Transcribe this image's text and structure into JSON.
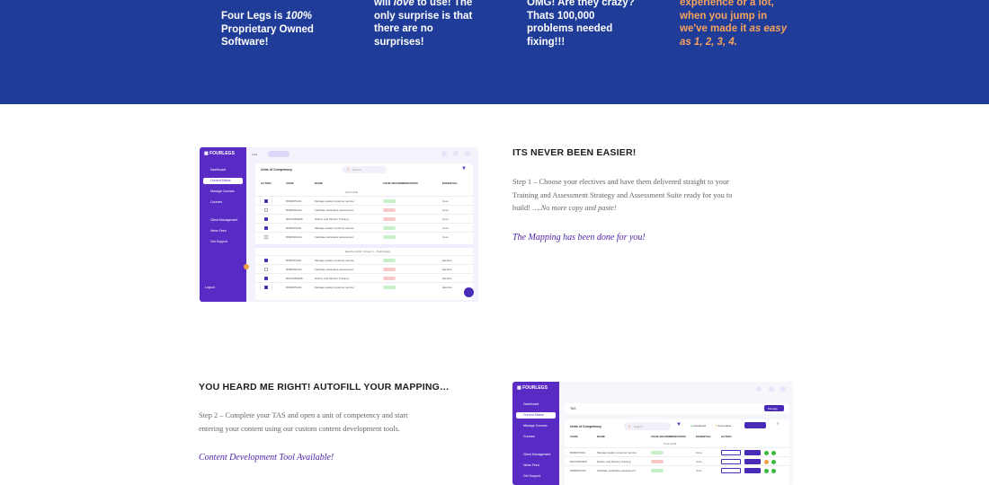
{
  "hero": {
    "col1": {
      "line1_pre": "Four Legs is ",
      "line1_em": "100%",
      "line2": "Proprietary Owned",
      "line3": "Software!"
    },
    "col2": {
      "line0_pre": "will ",
      "line0_em": "love",
      "line0_post": " to use! The",
      "line1": "only surprise is that",
      "line2": "there are no",
      "line3": "surprises!"
    },
    "col3": {
      "line0": "OMG! Are they crazy?",
      "line1": "Thats 100,000",
      "line2": "problems needed",
      "line3": "fixing!!!"
    },
    "col4": {
      "line0": "experience or a lot,",
      "line1": "when you jump in",
      "line2_pre": "we've made it ",
      "line2_em": "as easy",
      "line3_em": "as 1, 2, 3, 4."
    }
  },
  "step1": {
    "title": "ITS NEVER BEEN EASIER!",
    "text_line1": "Step 1 – Choose your electives and have them delivered straight to your",
    "text_line2": "Training and Assessment Strategy and Assessment Suite ready for you to",
    "text_line3_pre": "build!  ",
    "text_line3_em": "….No more copy and paste!",
    "highlight": "The Mapping has been done for you!"
  },
  "step2": {
    "title": "YOU HEARD ME RIGHT!  AUTOFILL YOUR MAPPING…",
    "text_line1": "Step 2 – Complete your TAS and open a unit of competency and start",
    "text_line2": "entering your content using our custom content development tools.",
    "highlight": "Content Development Tool Available!"
  },
  "shot1": {
    "brand": "FOURLEGS",
    "panel_title": "Units of Competency",
    "search_placeholder": "Search",
    "columns": [
      "ACTION",
      "CODE",
      "NAME",
      "COHE RECOMMENDATION",
      "ESSENTIAL"
    ],
    "group1": "Core Units",
    "group2": "Elective Units / Group A – Technology",
    "rows1": [
      {
        "checked": true,
        "code": "BSBOPS401",
        "name": "Manage quality customer service",
        "status": "g",
        "ess": "Core"
      },
      {
        "checked": false,
        "code": "BSBWHS411",
        "name": "Facilitate workplace assessment",
        "status": "r",
        "ess": "Core"
      },
      {
        "checked": true,
        "code": "BSCOMM408",
        "name": "Deliver and Monitor Training",
        "status": "r",
        "ess": "Core"
      },
      {
        "checked": true,
        "code": "BSBOPS401",
        "name": "Manage quality customer service",
        "status": "g",
        "ess": "Core"
      },
      {
        "checked": false,
        "code": "BSBWHS411",
        "name": "Facilitate workplace assessment",
        "status": "g",
        "ess": "Core"
      }
    ],
    "rows2": [
      {
        "checked": true,
        "code": "BSBOPS401",
        "name": "Manage quality customer service",
        "status": "g",
        "ess": "Elective"
      },
      {
        "checked": false,
        "code": "BSBWHS411",
        "name": "Facilitate workplace assessment",
        "status": "r",
        "ess": "Elective"
      },
      {
        "checked": true,
        "code": "BSCOMM408",
        "name": "Deliver and Monitor Training",
        "status": "r",
        "ess": "Elective"
      },
      {
        "checked": true,
        "code": "BSBOPS401",
        "name": "Manage quality customer service",
        "status": "g",
        "ess": "Elective"
      }
    ],
    "side_items": [
      "Dashboard",
      "Current Status",
      "Manage Courses",
      "Courses",
      "Client Management",
      "News Feed",
      "Get Support"
    ],
    "logout": "Logout"
  },
  "shot2": {
    "brand": "FOURLEGS",
    "tas_label": "TAS",
    "panel_title": "Units of Competency",
    "search_placeholder": "Search",
    "columns": [
      "CODE",
      "NAME",
      "COHE RECOMMENDATION",
      "ESSENTIAL",
      "ACTION"
    ],
    "group1": "Core Units",
    "legend": [
      "Completed",
      "Incomplete"
    ],
    "button": "Manage",
    "rows": [
      {
        "code": "BSBOPS401",
        "name": "Manage quality customer service",
        "status": "g",
        "ess": "Core"
      },
      {
        "code": "BSCOMM408",
        "name": "Deliver and Monitor Training",
        "status": "r",
        "ess": "Core"
      },
      {
        "code": "BSBWHS411",
        "name": "Facilitate workplace assessment",
        "status": "g",
        "ess": "Core"
      }
    ],
    "side_items": [
      "Dashboard",
      "Current Status",
      "Manage Courses",
      "Courses",
      "Client Management",
      "News Feed",
      "Get Support"
    ]
  },
  "colors": {
    "hero_bg": "#1f3c98",
    "accent_orange": "#f7a35c",
    "brand_purple": "#5a2bc4",
    "highlight_purple": "#4a1fa6"
  }
}
